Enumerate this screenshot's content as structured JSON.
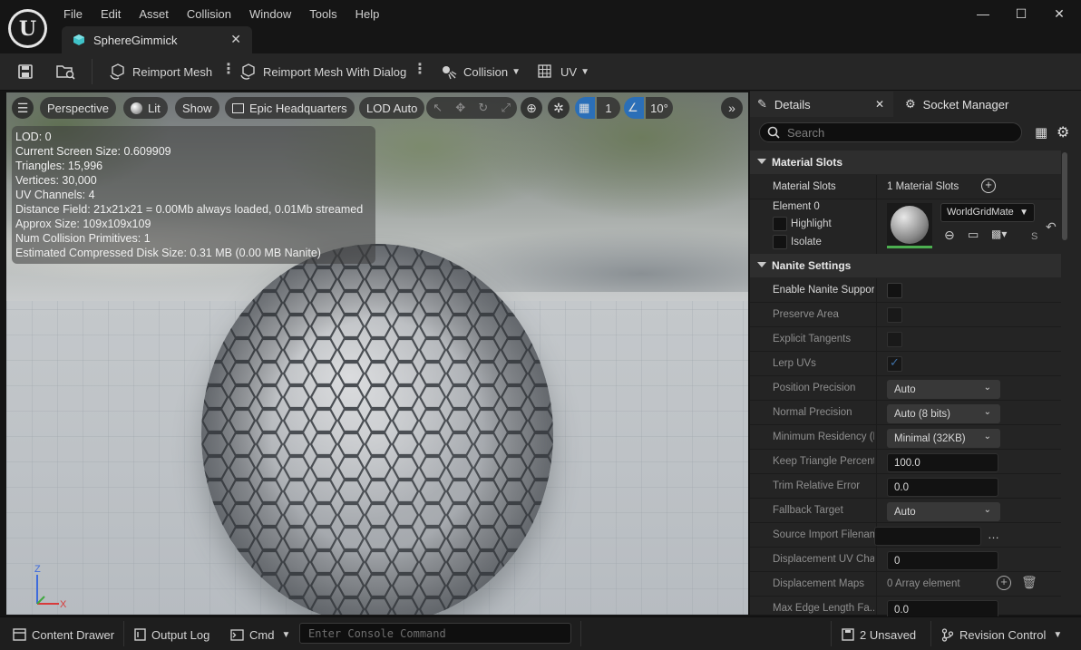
{
  "window": {
    "menu": [
      "File",
      "Edit",
      "Asset",
      "Collision",
      "Window",
      "Tools",
      "Help"
    ],
    "tab_title": "SphereGimmick",
    "controls": {
      "minimize": "—",
      "maximize": "☐",
      "close": "✕"
    }
  },
  "toolbar": {
    "reimport_mesh": "Reimport Mesh",
    "reimport_dialog": "Reimport Mesh With Dialog",
    "collision": "Collision",
    "uv": "UV"
  },
  "viewport": {
    "perspective": "Perspective",
    "lit": "Lit",
    "show": "Show",
    "environment": "Epic Headquarters",
    "lod": "LOD Auto",
    "grid_value": "1",
    "angle_value": "10°",
    "stats": [
      "LOD:  0",
      "Current Screen Size:  0.609909",
      "Triangles:  15,996",
      "Vertices:  30,000",
      "UV Channels:  4",
      "Distance Field:  21x21x21 = 0.00Mb always loaded, 0.01Mb streamed",
      "Approx Size: 109x109x109",
      "Num Collision Primitives:  1",
      "Estimated Compressed Disk Size: 0.31 MB (0.00 MB Nanite)"
    ],
    "axis": {
      "z": "Z",
      "x": "X"
    }
  },
  "details": {
    "tab_details": "Details",
    "tab_socket": "Socket Manager",
    "search_placeholder": "Search",
    "material_slots_section": "Material Slots",
    "material_slots_label": "Material Slots",
    "material_slots_value": "1 Material Slots",
    "element_label": "Element 0",
    "highlight": "Highlight",
    "isolate": "Isolate",
    "material_name": "WorldGridMate",
    "nanite_section": "Nanite Settings",
    "rows": [
      {
        "label": "Enable Nanite Support",
        "type": "checkbox",
        "checked": false,
        "bright": true
      },
      {
        "label": "Preserve Area",
        "type": "checkbox",
        "checked": false
      },
      {
        "label": "Explicit Tangents",
        "type": "checkbox",
        "checked": false
      },
      {
        "label": "Lerp UVs",
        "type": "checkbox",
        "checked": true
      },
      {
        "label": "Position Precision",
        "type": "dropdown",
        "value": "Auto"
      },
      {
        "label": "Normal Precision",
        "type": "dropdown",
        "value": "Auto (8 bits)"
      },
      {
        "label": "Minimum Residency (R",
        "type": "dropdown",
        "value": "Minimal (32KB)"
      },
      {
        "label": "Keep Triangle Percent",
        "type": "number",
        "value": "100.0"
      },
      {
        "label": "Trim Relative Error",
        "type": "number",
        "value": "0.0"
      },
      {
        "label": "Fallback Target",
        "type": "dropdown",
        "value": "Auto"
      },
      {
        "label": "Source Import Filenam",
        "type": "text",
        "value": ""
      },
      {
        "label": "Displacement UV Chan",
        "type": "number",
        "value": "0"
      },
      {
        "label": "Displacement Maps",
        "type": "array",
        "value": "0 Array element"
      },
      {
        "label": "Max Edge Length Fa...",
        "type": "number",
        "value": "0.0"
      }
    ]
  },
  "statusbar": {
    "content_drawer": "Content Drawer",
    "output_log": "Output Log",
    "cmd": "Cmd",
    "console_placeholder": "Enter Console Command",
    "unsaved": "2 Unsaved",
    "revision_control": "Revision Control"
  },
  "colors": {
    "accent_blue": "#2b6fb8",
    "tab_icon": "#3fc2c8",
    "background": "#151515",
    "panel": "#242424"
  }
}
